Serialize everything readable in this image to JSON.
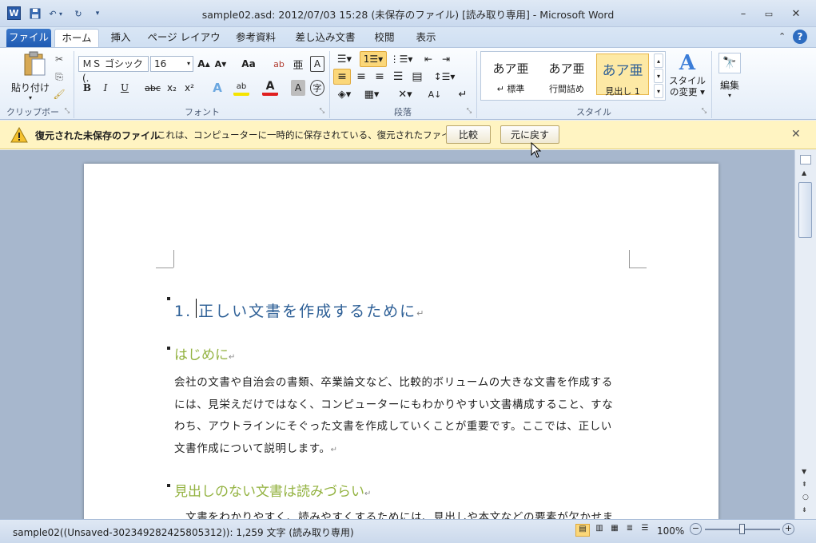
{
  "window": {
    "title": "sample02.asd: 2012/07/03 15:28 (未保存のファイル) [読み取り専用] - Microsoft Word",
    "app_icon": "W"
  },
  "tabs": [
    {
      "label": "ファイル"
    },
    {
      "label": "ホーム"
    },
    {
      "label": "挿入"
    },
    {
      "label": "ページ レイアウト"
    },
    {
      "label": "参考資料"
    },
    {
      "label": "差し込み文書"
    },
    {
      "label": "校閲"
    },
    {
      "label": "表示"
    }
  ],
  "ribbon": {
    "clipboard": {
      "paste_label": "貼り付け",
      "group_label": "クリップボード"
    },
    "font": {
      "font_name": "ＭＳ ゴシック (.",
      "font_size": "16",
      "group_label": "フォント",
      "bold": "B",
      "italic": "I",
      "underline": "U",
      "strike": "abc",
      "sub": "x₂",
      "sup": "x²",
      "aa": "Aa"
    },
    "paragraph": {
      "group_label": "段落"
    },
    "styles": {
      "items": [
        {
          "sample": "あア亜",
          "name": "↵ 標準"
        },
        {
          "sample": "あア亜",
          "name": "行間詰め"
        },
        {
          "sample": "あア亜",
          "name": "見出し 1"
        }
      ],
      "change_label": "スタイルの変更 ▾",
      "group_label": "スタイル"
    },
    "editing": {
      "label": "編集"
    }
  },
  "message_bar": {
    "title": "復元された未保存のファイル",
    "text": "これは、コンピューターに一時的に保存されている、復元されたファイルです。",
    "compare_label": "比較",
    "restore_label": "元に戻す"
  },
  "document": {
    "heading1": "1. 正しい文書を作成するために",
    "heading2a": "はじめに",
    "paragraph1": [
      "会社の文書や自治会の書類、卒業論文など、比較的ボリュームの大きな文書を作成する",
      "には、見栄えだけではなく、コンピューターにもわかりやすい文書構成すること、すな",
      "わち、アウトラインにそぐった文書を作成していくことが重要です。ここでは、正しい",
      "文書作成について説明します。"
    ],
    "heading2b": "見出しのない文書は読みづらい",
    "paragraph2_partial": "　文書をわかりやすく、読みやすくするためには、見出しや本文などの要素が欠かせま",
    "para_mark": "↵"
  },
  "status_bar": {
    "text": "sample02((Unsaved-302349282425805312)): 1,259 文字 (読み取り専用)",
    "zoom": "100%"
  },
  "colors": {
    "heading1": "#2d5f96",
    "heading2": "#94b342",
    "message_bar": "#fff4c2",
    "file_tab": "#2a66bd"
  }
}
